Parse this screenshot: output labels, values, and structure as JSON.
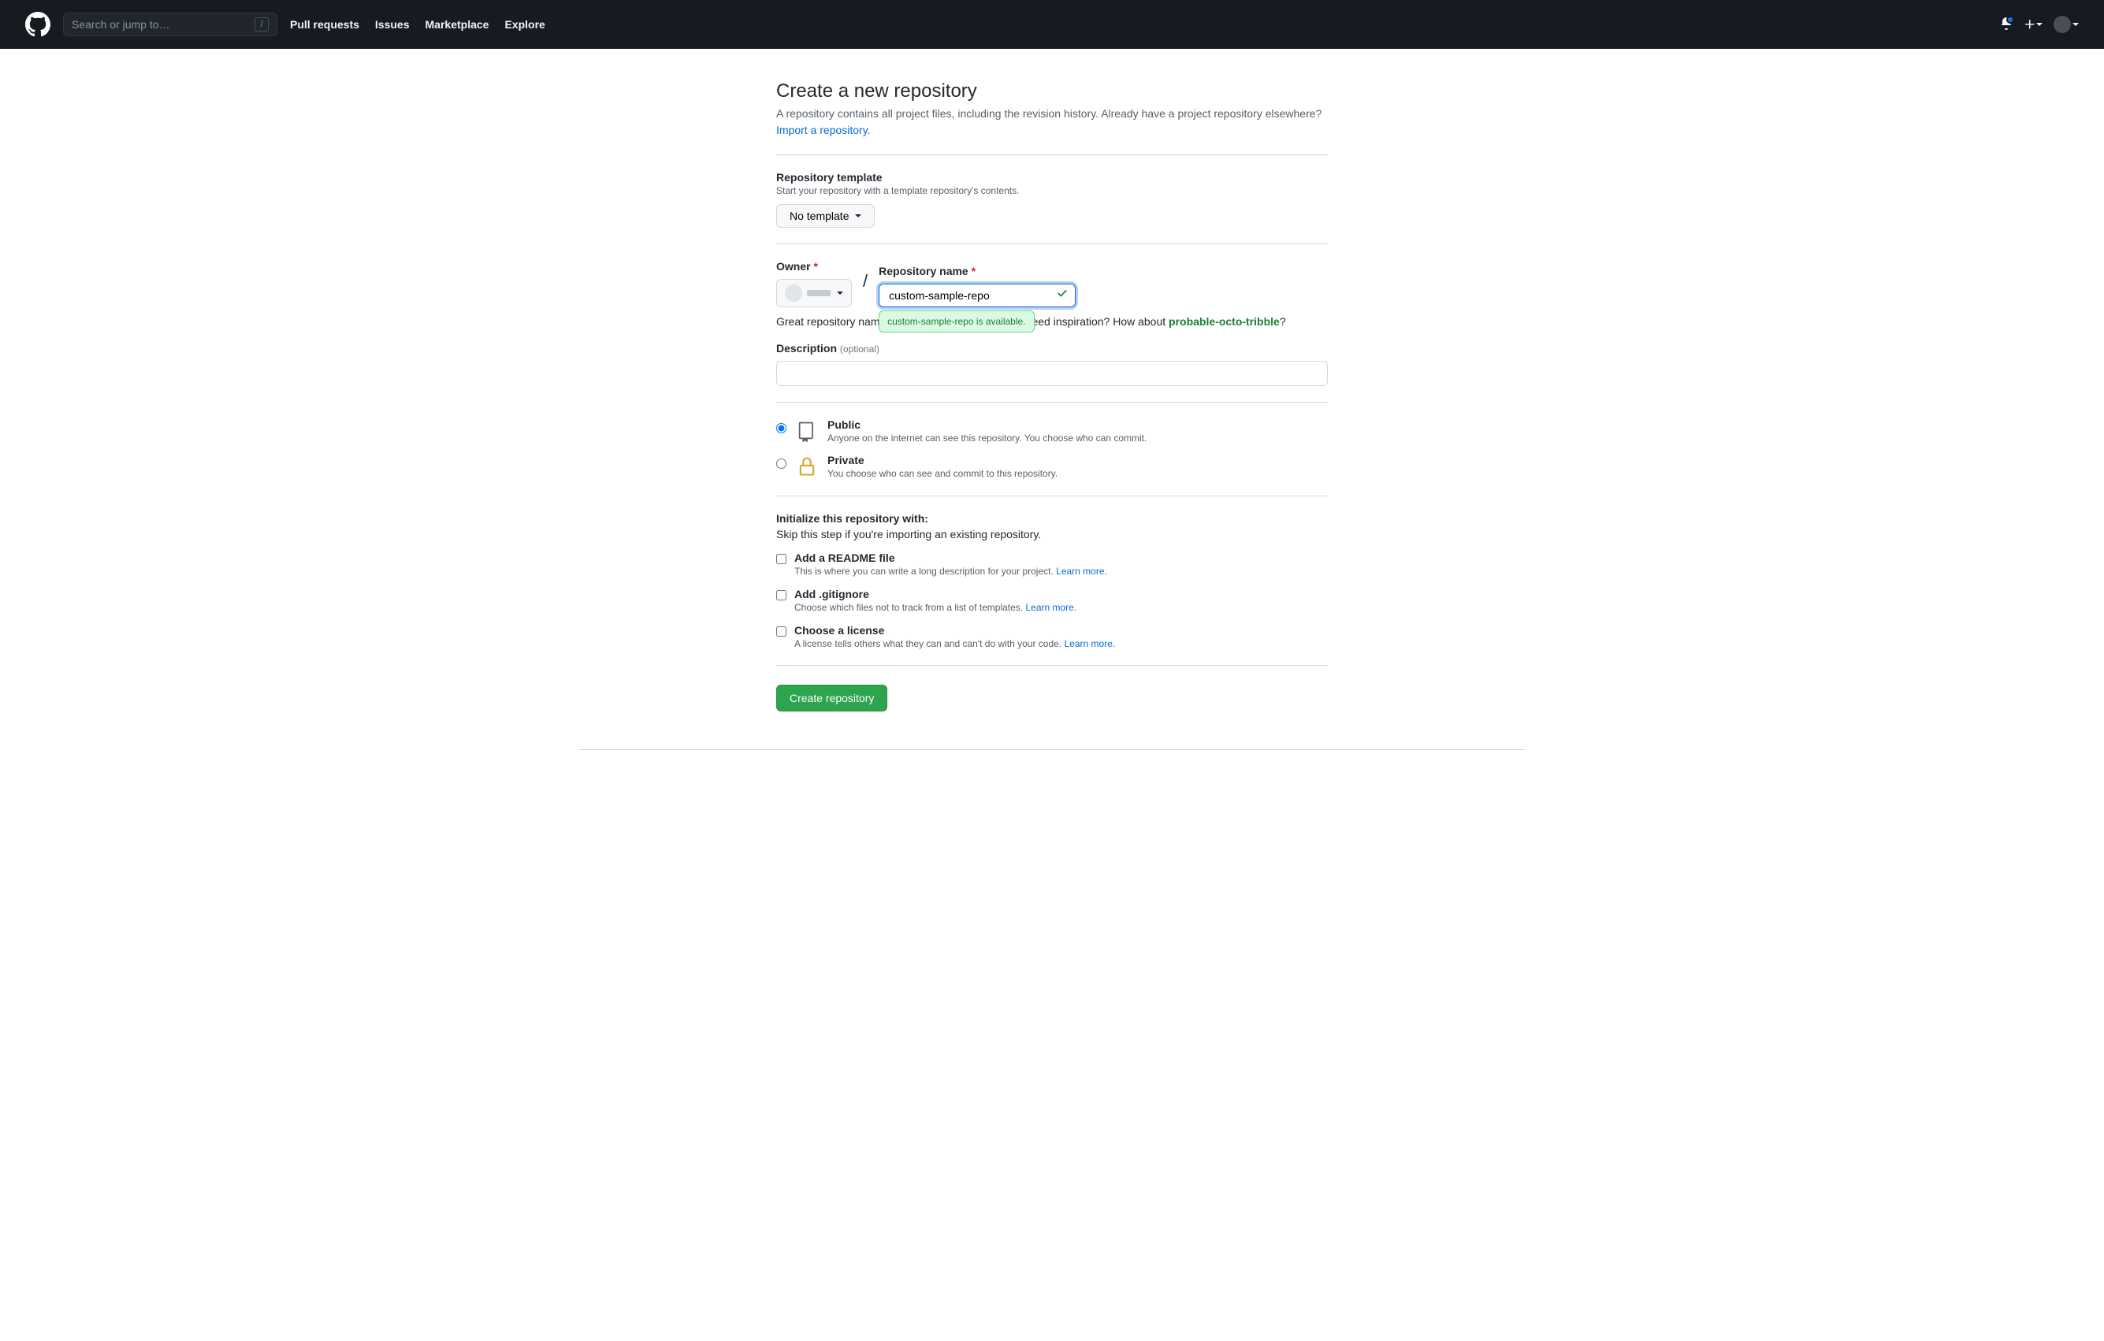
{
  "header": {
    "search_placeholder": "Search or jump to…",
    "slash_key": "/",
    "nav": [
      "Pull requests",
      "Issues",
      "Marketplace",
      "Explore"
    ]
  },
  "page": {
    "title": "Create a new repository",
    "subtitle_prefix": "A repository contains all project files, including the revision history. Already have a project repository elsewhere? ",
    "import_link": "Import a repository."
  },
  "template": {
    "label": "Repository template",
    "sublabel": "Start your repository with a template repository's contents.",
    "button": "No template"
  },
  "owner": {
    "label": "Owner"
  },
  "repo_name": {
    "label": "Repository name",
    "value": "custom-sample-repo",
    "available_tip": "custom-sample-repo is available."
  },
  "inspire": {
    "prefix": "Great repository names are short and memorable. Need inspiration? How about ",
    "suggestion": "probable-octo-tribble",
    "suffix": "?"
  },
  "description": {
    "label": "Description",
    "optional": "(optional)",
    "value": ""
  },
  "visibility": {
    "public": {
      "title": "Public",
      "desc": "Anyone on the internet can see this repository. You choose who can commit."
    },
    "private": {
      "title": "Private",
      "desc": "You choose who can see and commit to this repository."
    }
  },
  "initialize": {
    "heading": "Initialize this repository with:",
    "note": "Skip this step if you're importing an existing repository.",
    "readme": {
      "title": "Add a README file",
      "desc_prefix": "This is where you can write a long description for your project. ",
      "learn": "Learn more."
    },
    "gitignore": {
      "title": "Add .gitignore",
      "desc_prefix": "Choose which files not to track from a list of templates. ",
      "learn": "Learn more."
    },
    "license": {
      "title": "Choose a license",
      "desc_prefix": "A license tells others what they can and can't do with your code. ",
      "learn": "Learn more."
    }
  },
  "submit": "Create repository"
}
